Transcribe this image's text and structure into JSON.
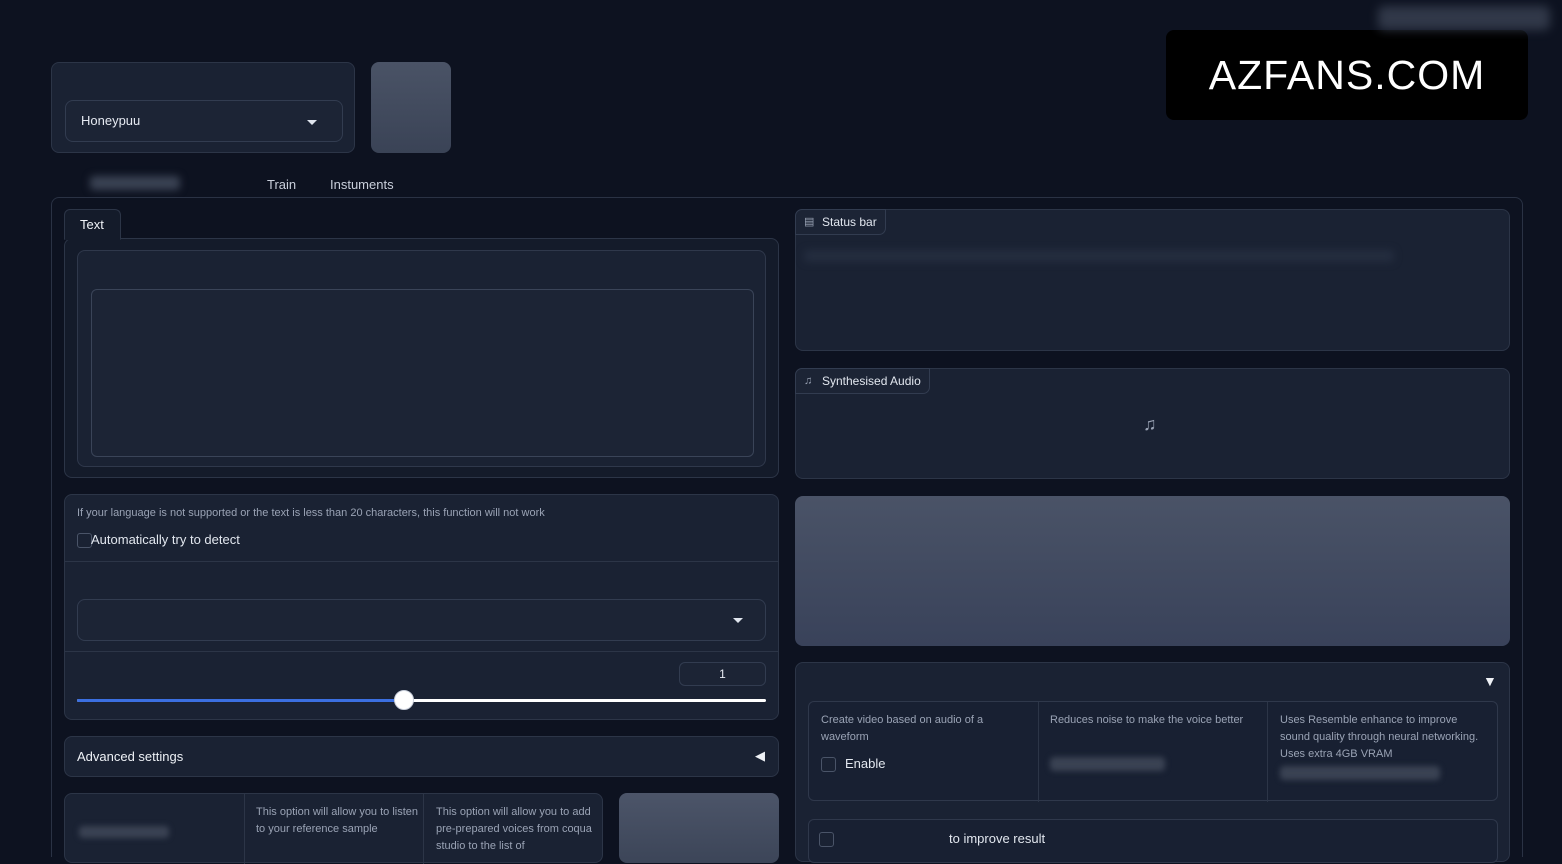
{
  "model_selector": {
    "value": "Honeypuu"
  },
  "tabs": [
    {
      "label": "Train"
    },
    {
      "label": "Instuments"
    }
  ],
  "watermark": {
    "text": "AZFANS.COM"
  },
  "text_panel": {
    "tab_label": "Text"
  },
  "language": {
    "warning": "If your language is not supported or the text is less than 20 characters, this function will not work",
    "auto_detect_label": "Automatically try to detect"
  },
  "slider": {
    "value": "1",
    "fraction": 0.475
  },
  "advanced": {
    "label": "Advanced settings"
  },
  "bottom_options": {
    "listen_desc": "This option will allow you to listen to your reference sample",
    "coqua_desc": "This option will allow you to add pre-prepared voices from coqua studio to the list of"
  },
  "status_bar": {
    "label": "Status bar"
  },
  "synth_audio": {
    "label": "Synthesised Audio",
    "icon": "music-note-icon"
  },
  "features": [
    {
      "desc": "Create video based on audio of a waveform",
      "check_label": "Enable"
    },
    {
      "desc": "Reduces noise to make the voice better"
    },
    {
      "desc": "Uses Resemble enhance to improve sound quality through neural networking. Uses extra 4GB VRAM"
    }
  ],
  "improve": {
    "label": "to improve result"
  },
  "colors": {
    "accent": "#3b6fe0",
    "background": "#0d1220"
  }
}
